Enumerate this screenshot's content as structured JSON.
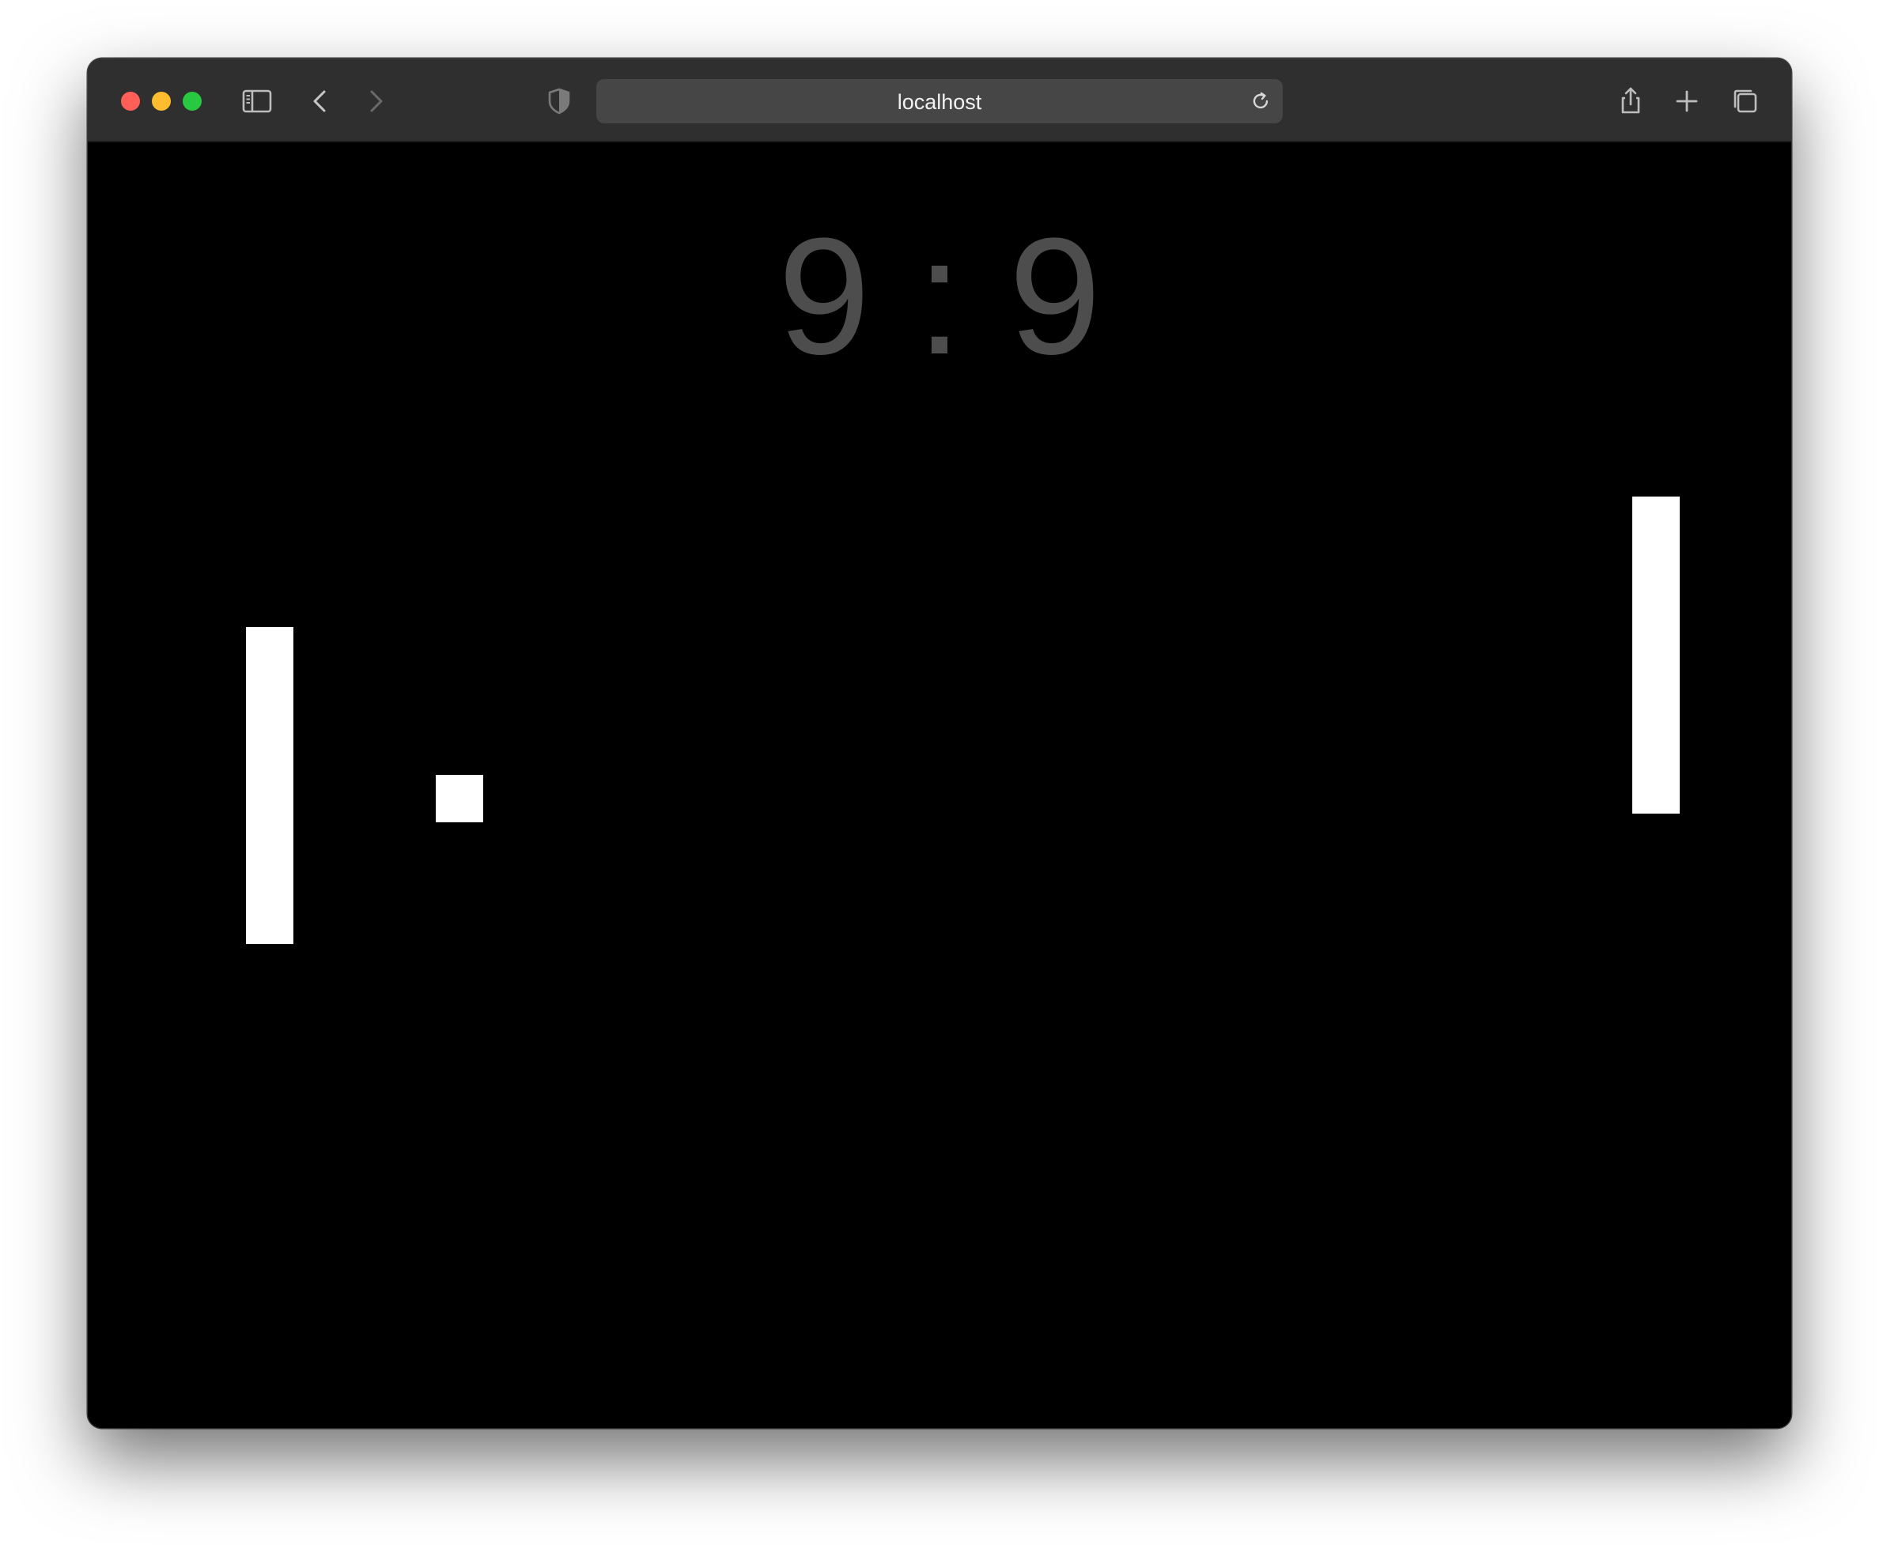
{
  "browser": {
    "url": "localhost",
    "icons": {
      "sidebar": "sidebar-icon",
      "back": "chevron-left-icon",
      "forward": "chevron-right-icon",
      "privacy": "shield-icon",
      "reload": "reload-icon",
      "share": "share-icon",
      "new_tab": "plus-icon",
      "tab_overview": "tabs-icon"
    },
    "colors": {
      "toolbar": "#2f2f2f",
      "address_bar": "#464646",
      "close": "#ff5f57",
      "minimize": "#febc2e",
      "maximize": "#28c840"
    }
  },
  "game": {
    "score": {
      "left": "9",
      "separator": ":",
      "right": "9"
    },
    "colors": {
      "background": "#000000",
      "score": "#4d4d4d",
      "paddles_and_ball": "#ffffff"
    }
  }
}
